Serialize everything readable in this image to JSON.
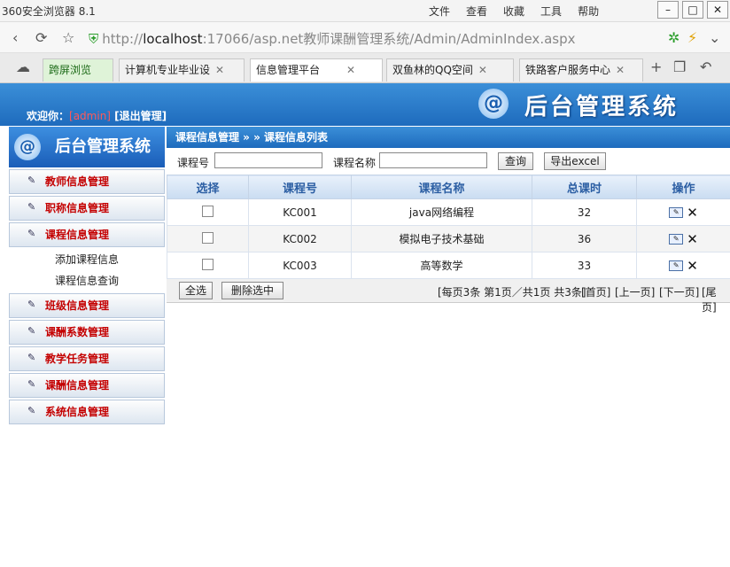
{
  "browser": {
    "app_title": "360安全浏览器 8.1",
    "menus": [
      "文件",
      "查看",
      "收藏",
      "工具",
      "帮助"
    ],
    "url_prefix": "http://",
    "url_host": "localhost",
    "url_rest": ":17066/asp.net教师课酬管理系统/Admin/AdminIndex.aspx",
    "tabs": [
      {
        "label": "跨屏浏览"
      },
      {
        "label": "计算机专业毕业设"
      },
      {
        "label": "信息管理平台"
      },
      {
        "label": "双鱼林的QQ空间"
      },
      {
        "label": "铁路客户服务中心"
      }
    ]
  },
  "header": {
    "welcome": "欢迎你：",
    "username": "[admin]",
    "logout": "[退出管理]",
    "system_title": "后台管理系统"
  },
  "sidebar": {
    "title": "后台管理系统",
    "items": [
      {
        "label": "教师信息管理"
      },
      {
        "label": "职称信息管理"
      },
      {
        "label": "课程信息管理"
      }
    ],
    "subitems": [
      {
        "label": "添加课程信息"
      },
      {
        "label": "课程信息查询"
      }
    ],
    "items2": [
      {
        "label": "班级信息管理"
      },
      {
        "label": "课酬系数管理"
      },
      {
        "label": "教学任务管理"
      },
      {
        "label": "课酬信息管理"
      },
      {
        "label": "系统信息管理"
      }
    ]
  },
  "main": {
    "breadcrumb": "课程信息管理 » » 课程信息列表",
    "search": {
      "course_no_label": "课程号",
      "course_name_label": "课程名称",
      "query_button": "查询",
      "export_button": "导出excel"
    },
    "table": {
      "headers": [
        "选择",
        "课程号",
        "课程名称",
        "总课时",
        "操作"
      ],
      "rows": [
        {
          "code": "KC001",
          "name": "java网络编程",
          "hours": "32"
        },
        {
          "code": "KC002",
          "name": "模拟电子技术基础",
          "hours": "36"
        },
        {
          "code": "KC003",
          "name": "高等数学",
          "hours": "33"
        }
      ]
    },
    "pager": {
      "select_all": "全选",
      "delete_selected": "删除选中",
      "info": "[每页3条 第1页／共1页 共3条]",
      "first": "[首页]",
      "prev": "[上一页]",
      "next": "[下一页]",
      "last": "[尾页]"
    }
  }
}
